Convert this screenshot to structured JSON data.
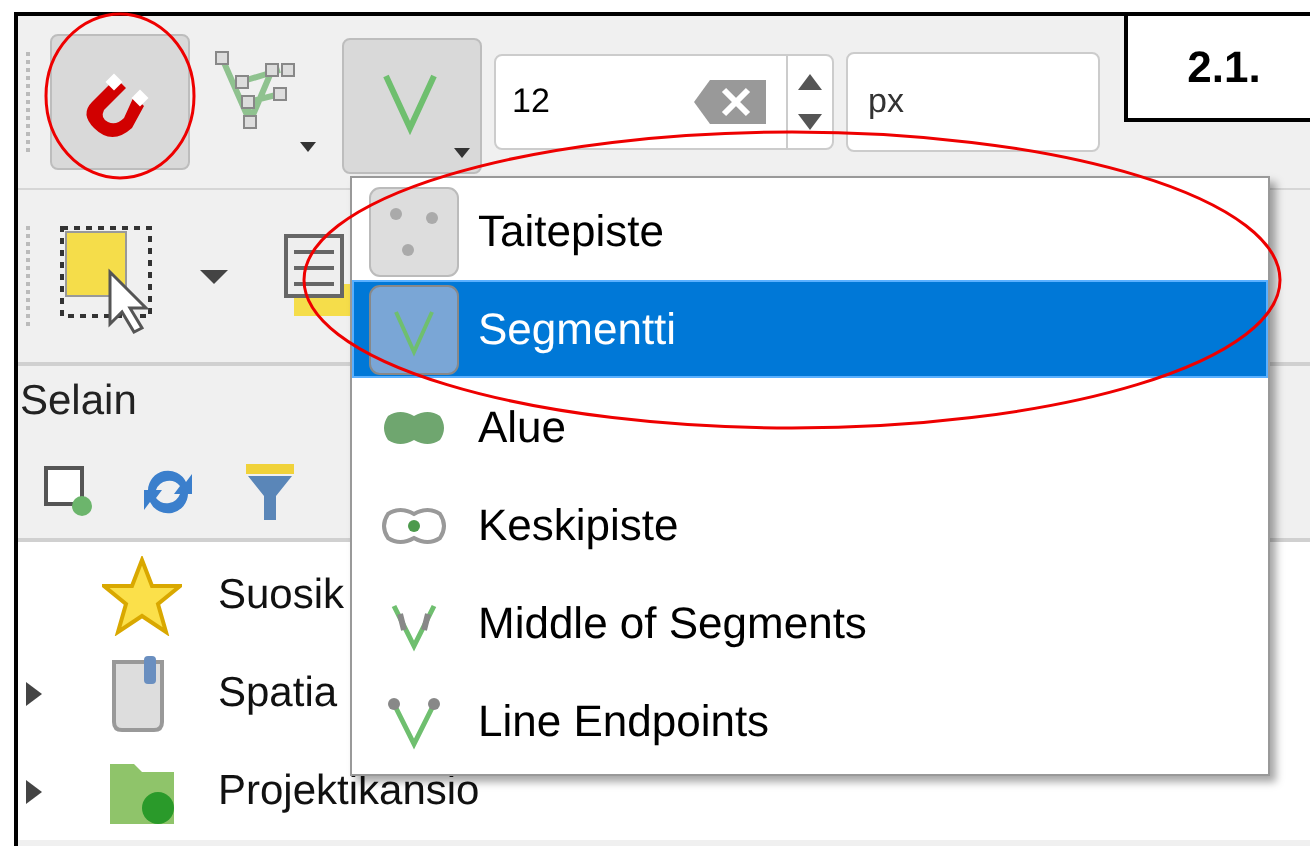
{
  "toolbar": {
    "buttons": [
      {
        "kind": "magnet",
        "pressed": true
      },
      {
        "kind": "vertex",
        "pressed": false
      },
      {
        "kind": "segment",
        "pressed": true
      }
    ],
    "tolerance": {
      "value": "12",
      "unit": "px"
    }
  },
  "step_label": "2.1.",
  "toolbar_2": {
    "buttons": [
      {
        "kind": "select"
      },
      {
        "kind": "table"
      }
    ]
  },
  "panel": {
    "title": "Selain",
    "tools": [
      {
        "kind": "add"
      },
      {
        "kind": "refresh"
      },
      {
        "kind": "filter"
      }
    ],
    "items": [
      {
        "label": "Suosik",
        "kind": "star",
        "expandable": false
      },
      {
        "label": "Spatia",
        "kind": "db",
        "expandable": true
      },
      {
        "label": "Projektikansio",
        "kind": "folder",
        "expandable": true
      }
    ]
  },
  "menu": {
    "items": [
      {
        "label": "Taitepiste",
        "kind": "vertex",
        "selected": false
      },
      {
        "label": "Segmentti",
        "kind": "segment",
        "selected": true
      },
      {
        "label": "Alue",
        "kind": "area",
        "selected": false
      },
      {
        "label": "Keskipiste",
        "kind": "centroid",
        "selected": false
      },
      {
        "label": "Middle of Segments",
        "kind": "middle",
        "selected": false
      },
      {
        "label": "Line Endpoints",
        "kind": "endpoints",
        "selected": false
      }
    ]
  }
}
